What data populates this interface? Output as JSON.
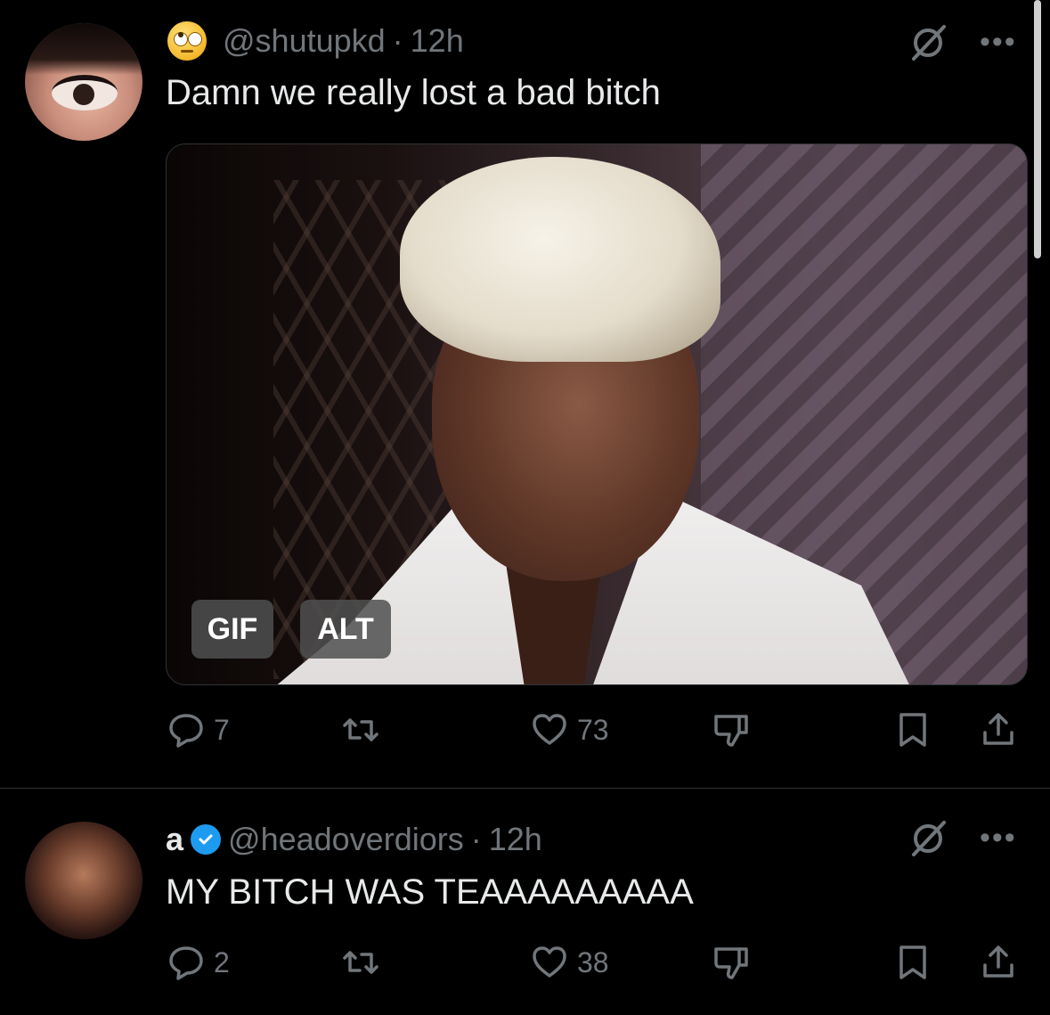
{
  "tweets": [
    {
      "handle": "@shutupkd",
      "separator": "·",
      "time": "12h",
      "text": "Damn we really lost a bad bitch",
      "media": {
        "badges": [
          "GIF",
          "ALT"
        ]
      },
      "actions": {
        "replies": "7",
        "retweets": "",
        "likes": "73"
      }
    },
    {
      "name": "a",
      "handle": "@headoverdiors",
      "separator": "·",
      "time": "12h",
      "text": "MY BITCH WAS TEAAAAAAAAA",
      "actions": {
        "replies": "2",
        "retweets": "",
        "likes": "38"
      }
    }
  ],
  "more_label": "•••",
  "colors": {
    "background": "#000000",
    "text": "#e7e9ea",
    "muted": "#71767b",
    "verified": "#1d9bf0",
    "divider": "#2f3336"
  }
}
